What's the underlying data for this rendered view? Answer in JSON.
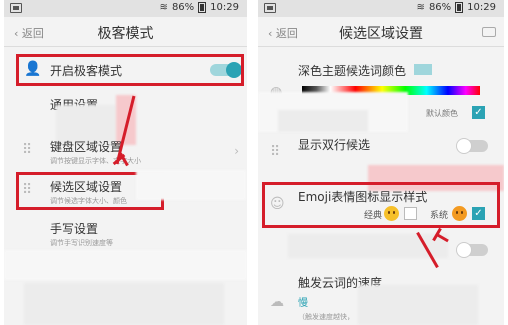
{
  "left": {
    "status": {
      "battery": "86%",
      "time": "10:29"
    },
    "back_label": "返回",
    "title": "极客模式",
    "rows": {
      "geek_mode": "开启极客模式",
      "general_settings": "通用设置",
      "keyboard_area": "键盘区域设置",
      "keyboard_area_sub": "调节按键显示字体、文字大小",
      "candidate_area": "候选区域设置",
      "candidate_area_sub": "调节候选字体大小、颜色",
      "handwriting": "手写设置",
      "handwriting_sub": "调节手写识别速度等"
    },
    "geek_mode_toggle": true
  },
  "right": {
    "status": {
      "battery": "86%",
      "time": "10:29"
    },
    "back_label": "返回",
    "title": "候选区域设置",
    "rows": {
      "dark_theme_color": "深色主题候选词颜色",
      "default_color": "默认颜色",
      "double_row": "显示双行候选",
      "emoji_style": "Emoji表情图标显示样式",
      "classic": "经典",
      "system": "系统",
      "cloud_speed": "触发云词的速度",
      "slow": "慢",
      "cloud_sub": "（触发速度越快，"
    },
    "default_color_checked": true,
    "double_row_toggle": false,
    "emoji_classic_checked": false,
    "emoji_system_checked": true
  },
  "colors": {
    "accent": "#2ba3b4",
    "highlight": "#d51d2a"
  }
}
